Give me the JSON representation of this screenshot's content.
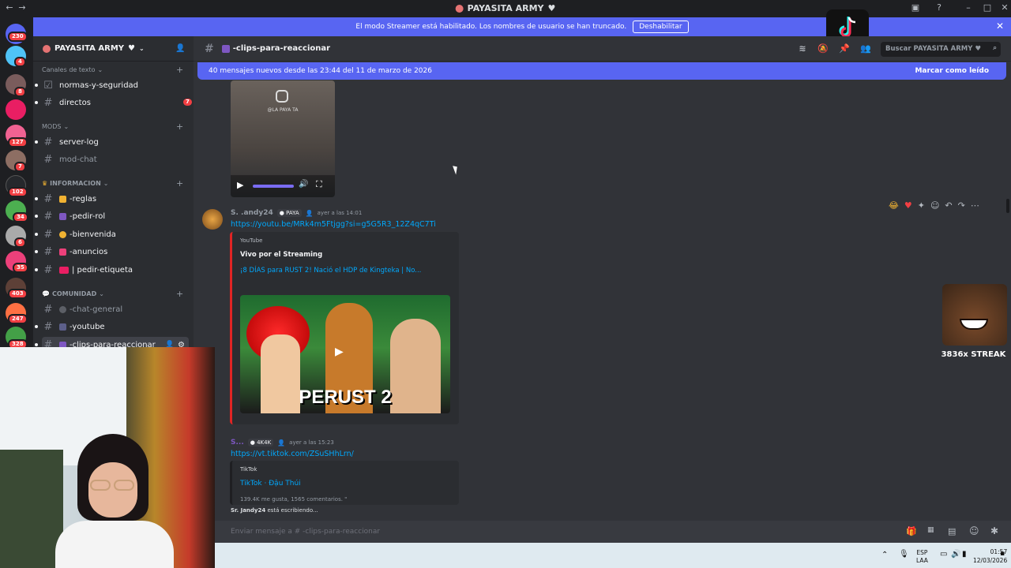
{
  "window": {
    "title": "PAYASITA ARMY",
    "heart": "♥"
  },
  "banner": {
    "text": "El modo Streamer está habilitado. Los nombres de usuario se han truncado.",
    "button": "Deshabilitar"
  },
  "servers": [
    {
      "badge": "230",
      "color": "#f23f43"
    },
    {
      "badge": "4",
      "color": "#4fc3f7"
    },
    {
      "badge": "8",
      "color": "#7a5c5c"
    },
    {
      "badge": "",
      "color": "#e91e63"
    },
    {
      "badge": "127",
      "color": "#f06292"
    },
    {
      "badge": "7",
      "color": "#8d6e63"
    },
    {
      "badge": "102",
      "color": "#1e1f22"
    },
    {
      "badge": "34",
      "color": "#4caf50"
    },
    {
      "badge": "6",
      "color": "#aaaaaa"
    },
    {
      "badge": "35",
      "color": "#ec407a"
    },
    {
      "badge": "403",
      "color": "#5d4037"
    },
    {
      "badge": "247",
      "color": "#ff7043"
    },
    {
      "badge": "328",
      "color": "#43a047"
    }
  ],
  "sidebar": {
    "server_name": "PAYASITA ARMY",
    "categories": {
      "text": "Canales de texto",
      "mods": "MODS",
      "info": "INFORMACION",
      "comunidad": "COMUNIDAD"
    },
    "channels": {
      "normas": "normas-y-seguridad",
      "directos": "directos",
      "directos_badge": "7",
      "serverlog": "server-log",
      "modchat": "mod-chat",
      "reglas": "-reglas",
      "pedirrol": "-pedir-rol",
      "bienvenida": "-bienvenida",
      "anuncios": "-anuncios",
      "etiqueta": "| pedir-etiqueta",
      "general": "-chat-general",
      "youtube": "-youtube",
      "clips": "-clips-para-reaccionar"
    }
  },
  "header": {
    "channel": "-clips-para-reaccionar",
    "search": "Buscar PAYASITA ARMY"
  },
  "newbar": {
    "text": "40 mensajes nuevos desde las 23:44 del 11 de marzo de 2026",
    "action": "Marcar como leído"
  },
  "video": {
    "handle": "@LA PAYA TA"
  },
  "messages": [
    {
      "user": "S.  .andy24",
      "tag": "PAYA",
      "time": "ayer a las 14:01",
      "link": "https://youtu.be/MRk4m5Ftjgg?si=g5G5R3_12Z4qC7Ti",
      "embed": {
        "provider": "YouTube",
        "author": "Vivo por el Streaming",
        "title": "¡8 DÍAS para RUST 2! Nació el HDP de Kingteka | No...",
        "thumb": "PERUST 2"
      }
    },
    {
      "user": "S...",
      "tag": "4K4K",
      "time": "ayer a las 15:23",
      "link": "https://vt.tiktok.com/ZSuSHhLrn/",
      "embed": {
        "provider": "TikTok",
        "title": "TikTok · Đậu Thúi",
        "stats": "139.4K me gusta, 1565 comentarios. \""
      }
    }
  ],
  "typing": {
    "user": "Sr. Jandy24",
    "text": "está escribiendo..."
  },
  "input": {
    "placeholder": "Enviar mensaje a # -clips-para-reaccionar"
  },
  "overlay": {
    "streak": "3836x STREAK"
  },
  "taskbar": {
    "lang1": "ESP",
    "lang2": "LAA",
    "time": "01:57",
    "date": "12/03/2026"
  }
}
